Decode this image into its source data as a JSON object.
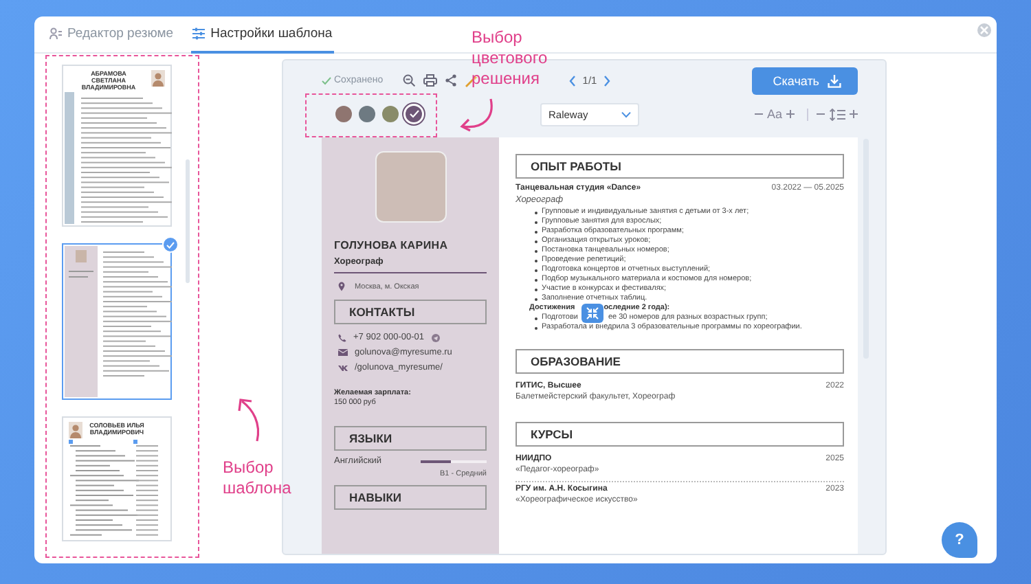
{
  "tabs": [
    {
      "label": "Редактор резюме",
      "selected": false
    },
    {
      "label": "Настройки шаблона",
      "selected": true
    }
  ],
  "templates": [
    {
      "kind": "classic",
      "name": "АБРАМОВА СВЕТЛАНА ВЛАДИМИРОВНА",
      "selected": false
    },
    {
      "kind": "two-column",
      "selected": true
    },
    {
      "kind": "modern",
      "name": "СОЛОВЬЕВ ИЛЬЯ ВЛАДИМИРОВИЧ",
      "selected": false
    }
  ],
  "toolbar": {
    "saved": "Сохранено",
    "page": "1/1",
    "download": "Скачать",
    "font": "Raleway",
    "font_size": "Aa"
  },
  "colors": [
    {
      "color": "#8f7570",
      "selected": false
    },
    {
      "color": "#6e7a82",
      "selected": false
    },
    {
      "color": "#898c69",
      "selected": false
    },
    {
      "color": "#6d5676",
      "selected": true
    }
  ],
  "resume": {
    "name": "ГОЛУНОВА КАРИНА",
    "position": "Хореограф",
    "location": "Москва, м. Окская",
    "contacts_title": "КОНТАКТЫ",
    "contacts": [
      {
        "kind": "phone",
        "text": "+7 902 000-00-01"
      },
      {
        "kind": "email",
        "text": "golunova@myresume.ru"
      },
      {
        "kind": "vk",
        "text": "/golunova_myresume/"
      }
    ],
    "salary_label": "Желаемая зарплата:",
    "salary": "150 000 руб",
    "languages_title": "ЯЗЫКИ",
    "languages": [
      {
        "name": "Английский",
        "level": 0.45,
        "grade": "B1 - Средний"
      }
    ],
    "skills_title": "НАВЫКИ",
    "experience_title": "ОПЫТ РАБОТЫ",
    "jobs": [
      {
        "company": "Танцевальная студия «Dance»",
        "dates": "03.2022 — 05.2025",
        "role": "Хореограф",
        "duties": [
          "Групповые и индивидуальные занятия с детьми от 3-х лет;",
          "Групповые занятия для взрослых;",
          "Разработка образовательных программ;",
          "Организация открытых уроков;",
          "Постановка танцевальных номеров;",
          "Проведение репетиций;",
          "Подготовка концертов и отчетных выступлений;",
          "Подбор музыкального материала и костюмов для номеров;",
          "Участие в конкурсах и фестивалях;",
          "Заполнение отчетных таблиц."
        ],
        "achievements_heading": [
          "Достижения",
          "оследние 2 года):"
        ],
        "achievements": [
          [
            "Подготови",
            "ее 30 номеров для разных возрастных групп;"
          ],
          [
            "Разработала и внедрила 3 образовательные программы по хореографии."
          ]
        ]
      }
    ],
    "education_title": "ОБРАЗОВАНИЕ",
    "education": [
      {
        "school": "ГИТИС, Высшее",
        "year": "2022",
        "detail": "Балетмейстерский факультет, Хореограф"
      }
    ],
    "courses_title": "КУРСЫ",
    "courses": [
      {
        "school": "НИИДПО",
        "year": "2025",
        "detail": "«Педагог-хореограф»"
      },
      {
        "school": "РГУ им. А.Н. Косыгина",
        "year": "2023",
        "detail": "«Хореографическое искусство»"
      }
    ]
  },
  "annotations": [
    {
      "text": "Выбор цветового решения"
    },
    {
      "text": "Выбор шаблона"
    }
  ],
  "help": "?"
}
